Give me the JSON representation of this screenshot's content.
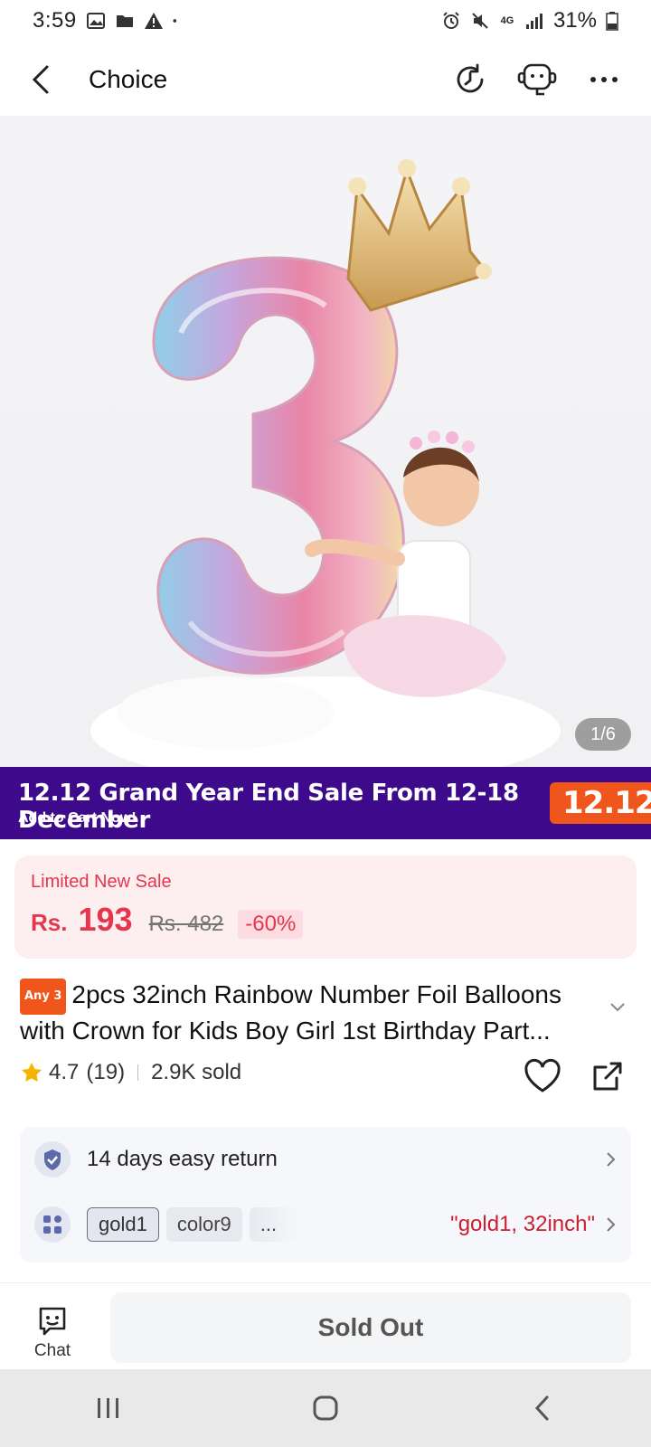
{
  "status_bar": {
    "time": "3:59",
    "battery": "31%",
    "network": "4G"
  },
  "header": {
    "title": "Choice"
  },
  "gallery": {
    "counter": "1/6"
  },
  "promo": {
    "title": "12.12 Grand Year End Sale From 12-18 December",
    "subtitle": "Add to Cart Now!",
    "badge": "12.12"
  },
  "price": {
    "tag": "Limited New Sale",
    "currency": "Rs.",
    "value": "193",
    "old": "Rs. 482",
    "discount": "-60%"
  },
  "product": {
    "badge": "Any 3",
    "title": "2pcs 32inch Rainbow Number Foil Balloons with Crown for Kids Boy Girl 1st Birthday Part..."
  },
  "rating": {
    "score": "4.7",
    "count": "(19)",
    "sold": "2.9K sold"
  },
  "service": {
    "return_text": "14 days easy return",
    "chips": [
      "gold1",
      "color9",
      "..."
    ],
    "selected_value": "\"gold1, 32inch\""
  },
  "bottom": {
    "chat_label": "Chat",
    "action_label": "Sold Out"
  },
  "colors": {
    "accent": "#e6364d",
    "promo_bg": "#3c0a8a",
    "promo_badge": "#f0551c"
  }
}
